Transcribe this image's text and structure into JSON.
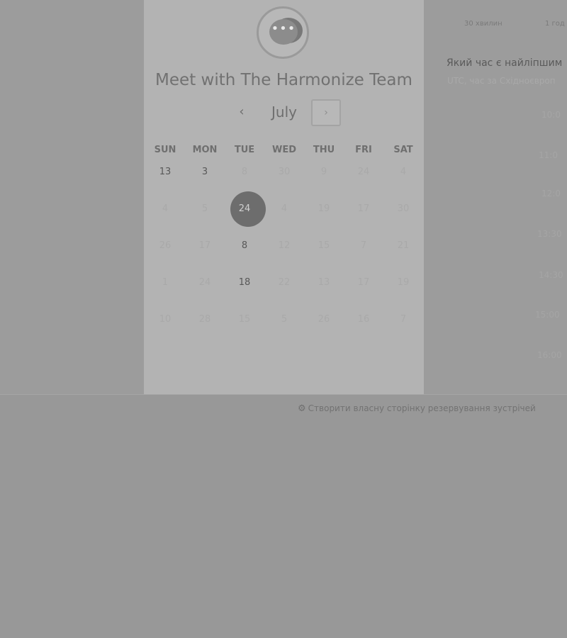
{
  "booking": {
    "title": "Meet with The Harmonize Team",
    "month": "July",
    "prev_icon": "‹",
    "next_icon": "›",
    "avatar_icon": "•••"
  },
  "calendar": {
    "weekdays": [
      "SUN",
      "MON",
      "TUE",
      "WED",
      "THU",
      "FRI",
      "SAT"
    ],
    "weeks": [
      [
        {
          "d": "13",
          "a": true
        },
        {
          "d": "3",
          "a": true
        },
        {
          "d": "8"
        },
        {
          "d": "30"
        },
        {
          "d": "9"
        },
        {
          "d": "24"
        },
        {
          "d": "4"
        }
      ],
      [
        {
          "d": "4"
        },
        {
          "d": "5"
        },
        {
          "d": "24",
          "sel": true
        },
        {
          "d": "4"
        },
        {
          "d": "19"
        },
        {
          "d": "17"
        },
        {
          "d": "30"
        }
      ],
      [
        {
          "d": "26"
        },
        {
          "d": "17"
        },
        {
          "d": "8",
          "a": true
        },
        {
          "d": "12"
        },
        {
          "d": "15"
        },
        {
          "d": "7"
        },
        {
          "d": "21"
        }
      ],
      [
        {
          "d": "1"
        },
        {
          "d": "24"
        },
        {
          "d": "18",
          "a": true
        },
        {
          "d": "22"
        },
        {
          "d": "13"
        },
        {
          "d": "17"
        },
        {
          "d": "19"
        }
      ],
      [
        {
          "d": "10"
        },
        {
          "d": "28"
        },
        {
          "d": "15"
        },
        {
          "d": "5"
        },
        {
          "d": "26"
        },
        {
          "d": "16"
        },
        {
          "d": "7"
        }
      ]
    ]
  },
  "side": {
    "durations": [
      "30 хвилин",
      "1 год"
    ],
    "question": "Який час є найліпшим",
    "timezone": "UTC, час за Східноєвроп",
    "slots": [
      "10:0",
      "11:0",
      "12:0",
      "13:30",
      "14:30",
      "15:00",
      "16:00"
    ]
  },
  "footer": {
    "link": "Створити власну сторінку резервування зустрічей",
    "icon": "⚙"
  }
}
